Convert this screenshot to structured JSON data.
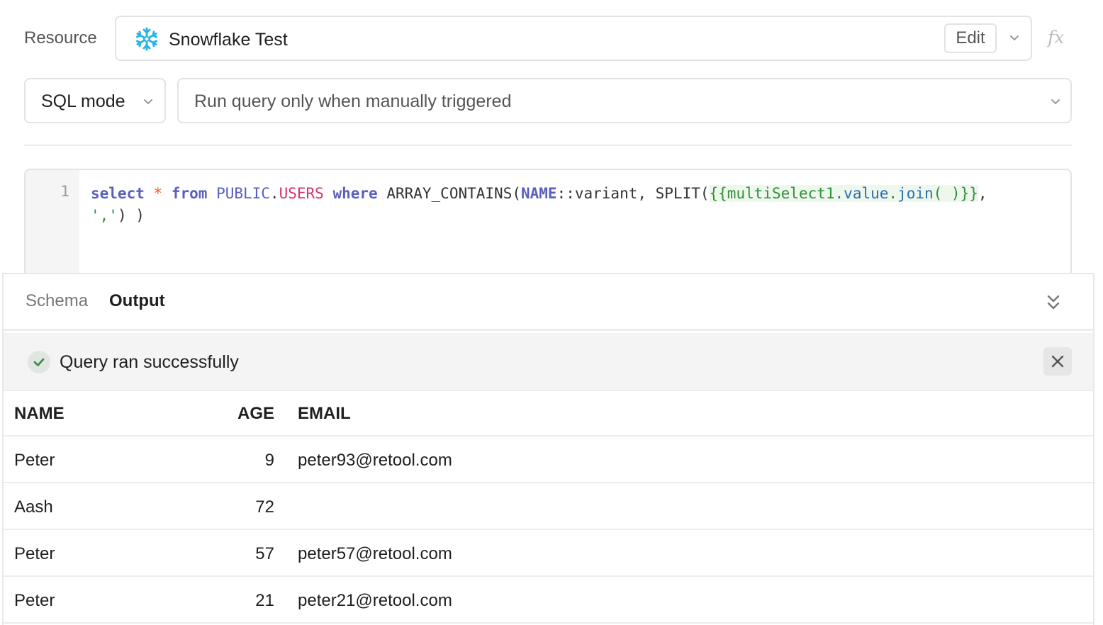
{
  "resource": {
    "label": "Resource",
    "name": "Snowflake Test",
    "edit_label": "Edit",
    "fx_label": "fx",
    "icon": "snowflake-icon",
    "icon_color": "#29b5e8"
  },
  "mode_select": {
    "value": "SQL mode"
  },
  "trigger_select": {
    "value": "Run query only when manually triggered"
  },
  "editor": {
    "line_number": "1",
    "tokens": {
      "select": "select",
      "star": "*",
      "from": "from",
      "schema": "PUBLIC",
      "dot": ".",
      "table": "USERS",
      "where": "where",
      "fn1": "ARRAY_CONTAINS(",
      "col": "NAME",
      "cast": "::variant, SPLIT(",
      "tmpl_open": "{{",
      "tmpl_id": "multiSelect1",
      "tmpl_dot1": ".",
      "tmpl_prop1": "value",
      "tmpl_dot2": ".",
      "tmpl_prop2": "join",
      "tmpl_args": "( )",
      "tmpl_close": "}}",
      "comma": ",",
      "str": "','",
      "end": ") )"
    }
  },
  "tabs": {
    "schema": "Schema",
    "output": "Output"
  },
  "status": {
    "text": "Query ran successfully",
    "color": "#3e8e4e"
  },
  "results": {
    "columns": [
      "NAME",
      "AGE",
      "EMAIL"
    ],
    "rows": [
      [
        "Peter",
        "9",
        "peter93@retool.com"
      ],
      [
        "Aash",
        "72",
        ""
      ],
      [
        "Peter",
        "57",
        "peter57@retool.com"
      ],
      [
        "Peter",
        "21",
        "peter21@retool.com"
      ]
    ]
  }
}
